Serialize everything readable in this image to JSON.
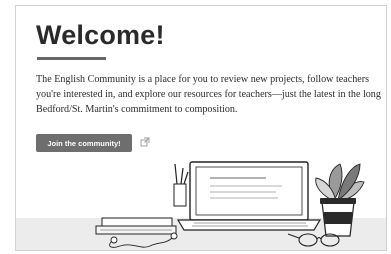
{
  "page": {
    "title": "Welcome!",
    "description": "The English Community is a place for you to review new projects, follow teachers you're interested in, and explore our resources for teachers—just the latest in the long Bedford/St. Martin's commitment to composition.",
    "join_button_label": "Join the community!",
    "external_link_icon": "external-link-icon"
  },
  "illustration": {
    "subject": "desk with laptop, books, plant, coffee cup and glasses"
  },
  "colors": {
    "heading": "#2a2a2a",
    "button_bg": "#6e6e6e",
    "button_text": "#ffffff",
    "text": "#2b2b2b"
  }
}
